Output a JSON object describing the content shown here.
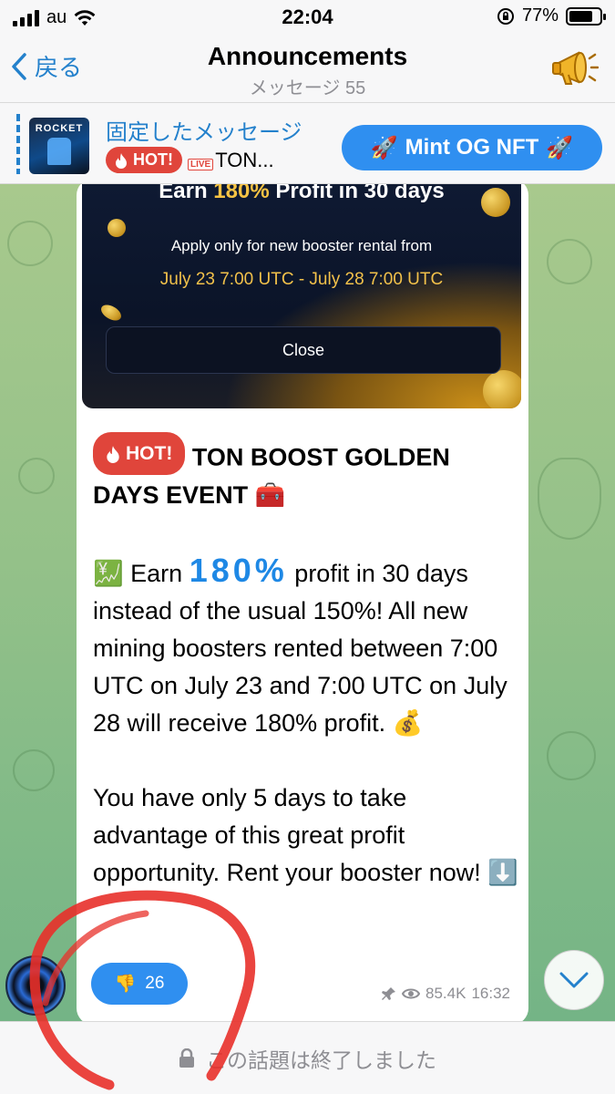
{
  "status_bar": {
    "carrier": "au",
    "time": "22:04",
    "battery": "77%",
    "battery_level": 0.77
  },
  "header": {
    "back_label": "戻る",
    "title": "Announcements",
    "subtitle": "メッセージ 55",
    "action_icon": "megaphone-icon"
  },
  "pinned": {
    "label": "固定したメッセージ",
    "hot": "HOT!",
    "live": "LIVE",
    "preview": "TON...",
    "thumb_text": "ROCKET",
    "mint_button": "Mint OG NFT"
  },
  "post": {
    "media": {
      "earn_prefix": "Earn ",
      "earn_highlight": "180%",
      "earn_suffix": " Profit in 30 days",
      "apply": "Apply only for new booster rental from",
      "dates": "July 23 7:00 UTC - July 28 7:00 UTC",
      "close": "Close"
    },
    "hot": "HOT!",
    "headline": "TON BOOST GOLDEN DAYS EVENT",
    "p1_before": "Earn",
    "p1_number": "180%",
    "p1_after": "profit in 30 days instead of the usual 150%! All new mining boosters rented between 7:00 UTC on July 23 and 7:00 UTC on July 28 will receive 180% profit.",
    "p2": "You have only 5 days to take advantage of this great profit opportunity. Rent your booster now!",
    "reaction_count": "26",
    "views": "85.4K",
    "time": "16:32"
  },
  "footer": {
    "closed_text": "この話題は終了しました"
  },
  "colors": {
    "accent": "#2481cc",
    "hot": "#e0453b",
    "button": "#2f8ff0"
  }
}
